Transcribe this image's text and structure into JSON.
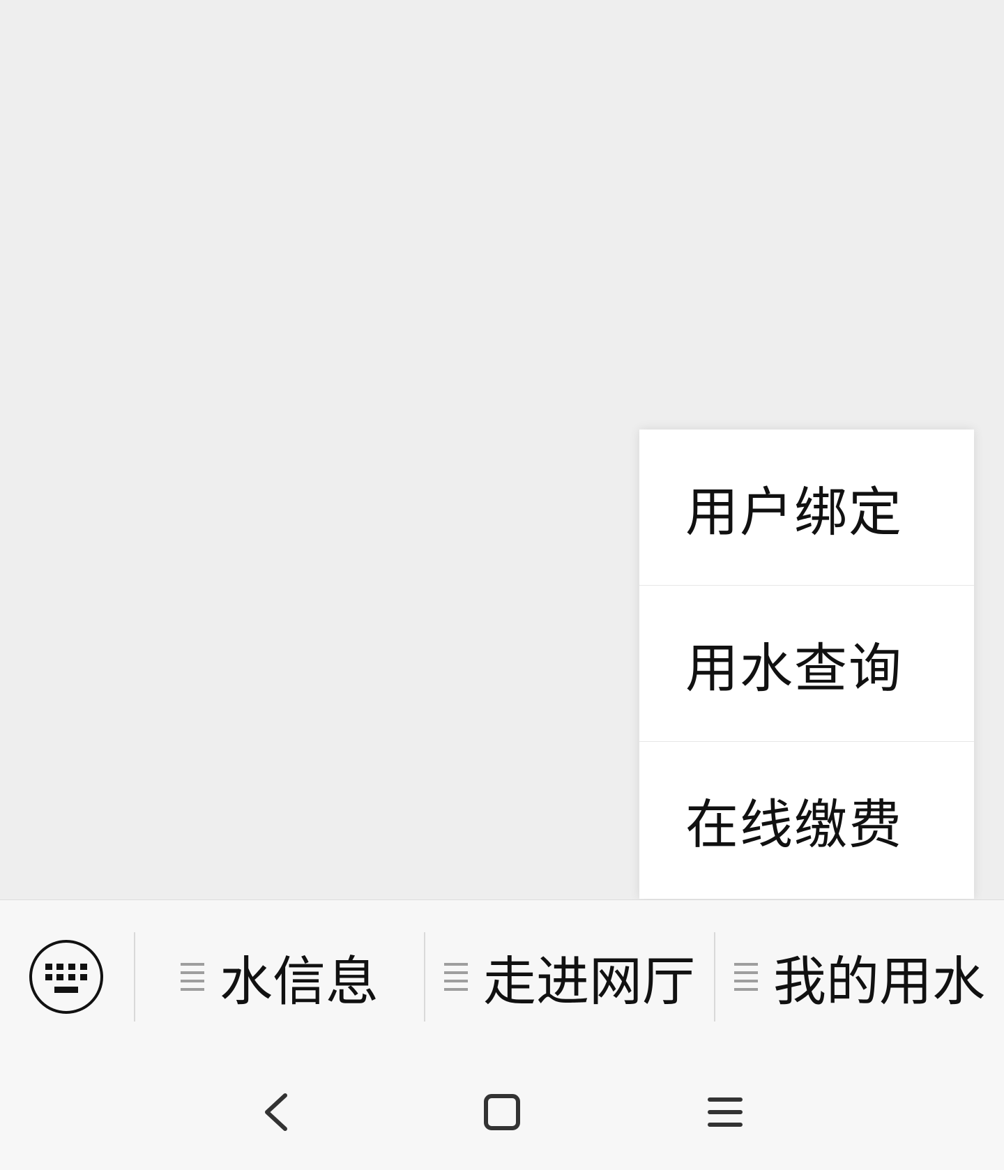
{
  "popup_menu": {
    "items": [
      {
        "label": "用户绑定"
      },
      {
        "label": "用水查询"
      },
      {
        "label": "在线缴费"
      }
    ]
  },
  "menu_bar": {
    "keyboard_icon": "keyboard-icon",
    "tabs": [
      {
        "label": "水信息",
        "icon": "menu-lines-icon"
      },
      {
        "label": "走进网厅",
        "icon": "menu-lines-icon"
      },
      {
        "label": "我的用水",
        "icon": "menu-lines-icon"
      }
    ]
  },
  "nav_bar": {
    "icons": [
      "back-icon",
      "home-icon",
      "recents-icon"
    ]
  },
  "colors": {
    "background": "#eeeeee",
    "bar": "#f7f7f7",
    "text": "#111111",
    "icon_gray": "#9e9e9e"
  }
}
